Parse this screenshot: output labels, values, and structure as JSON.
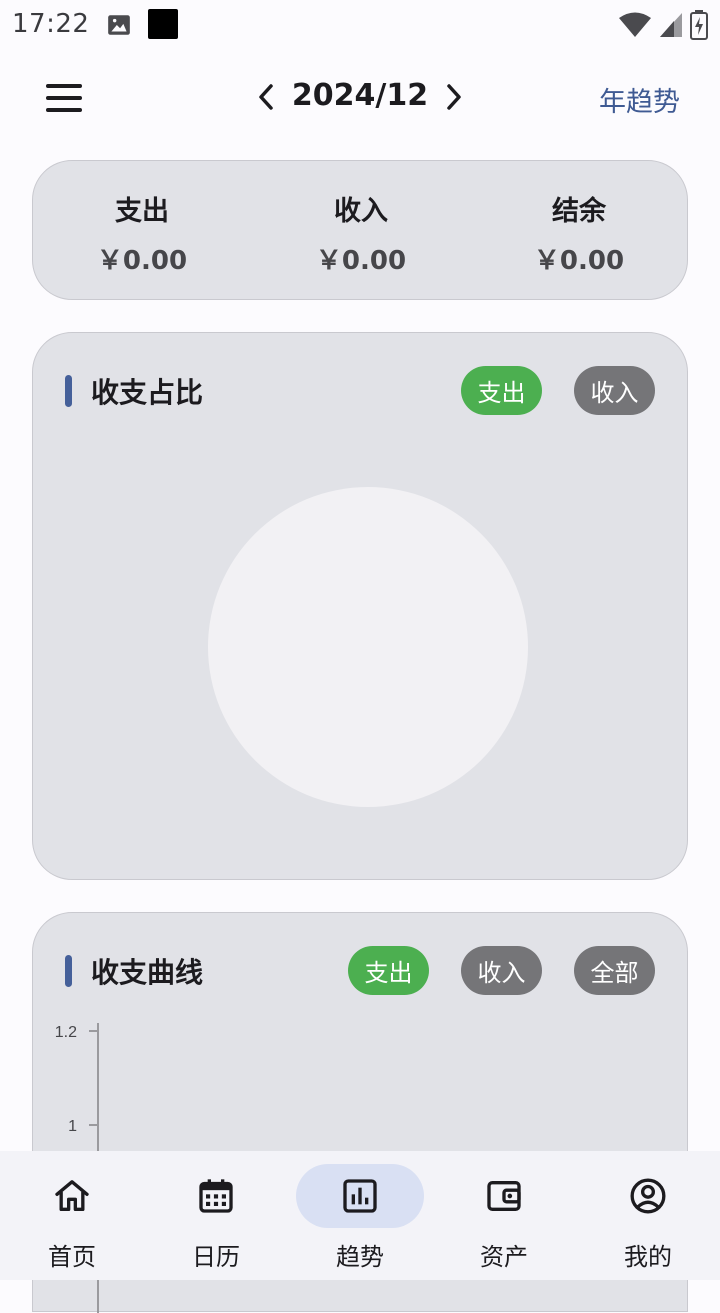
{
  "status_bar": {
    "time": "17:22"
  },
  "header": {
    "month": "2024/12",
    "year_trend": "年趋势"
  },
  "summary": [
    {
      "label": "支出",
      "value": "￥0.00"
    },
    {
      "label": "收入",
      "value": "￥0.00"
    },
    {
      "label": "结余",
      "value": "￥0.00"
    }
  ],
  "pie_card": {
    "title": "收支占比",
    "chips": [
      {
        "label": "支出",
        "active": true
      },
      {
        "label": "收入",
        "active": false
      }
    ]
  },
  "line_card": {
    "title": "收支曲线",
    "chips": [
      {
        "label": "支出",
        "active": true
      },
      {
        "label": "收入",
        "active": false
      },
      {
        "label": "全部",
        "active": false
      }
    ],
    "y_ticks": [
      "1.2",
      "1"
    ]
  },
  "chart_data": [
    {
      "type": "pie",
      "categories": [],
      "values": [],
      "title": "收支占比"
    },
    {
      "type": "line",
      "title": "收支曲线",
      "x": [],
      "series": [],
      "y_ticks": [
        1.2,
        1
      ]
    }
  ],
  "bottom_nav": [
    {
      "label": "首页",
      "icon": "home-icon",
      "active": false
    },
    {
      "label": "日历",
      "icon": "calendar-icon",
      "active": false
    },
    {
      "label": "趋势",
      "icon": "bar-chart-icon",
      "active": true
    },
    {
      "label": "资产",
      "icon": "wallet-icon",
      "active": false
    },
    {
      "label": "我的",
      "icon": "account-circle-icon",
      "active": false
    }
  ],
  "colors": {
    "accent": "#3f5a93",
    "chip_active": "#4caf50",
    "chip_inactive": "#757578",
    "nav_active_pill": "#d9e0f3"
  }
}
